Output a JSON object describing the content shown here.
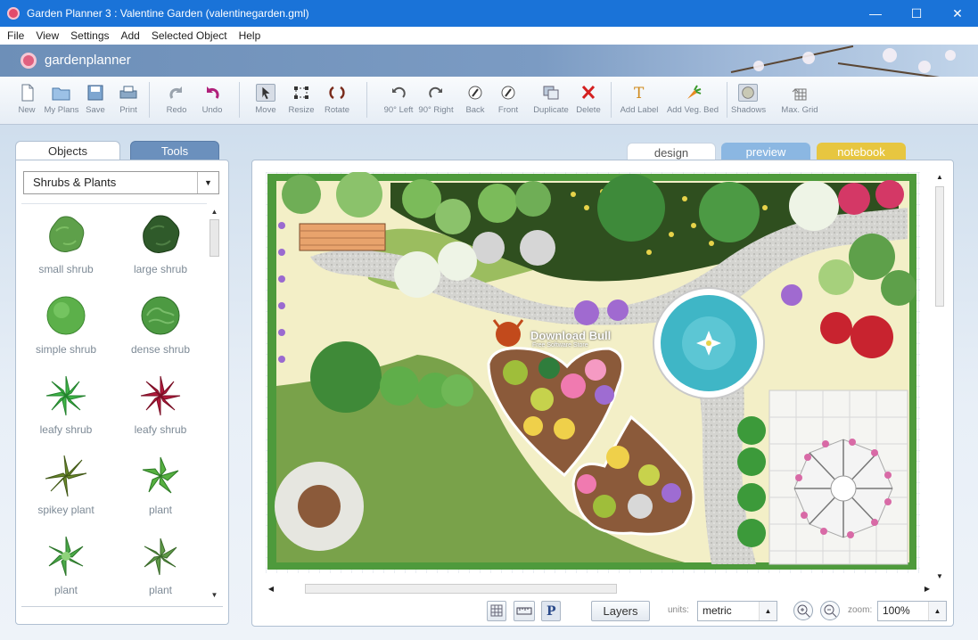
{
  "window": {
    "title": "Garden Planner 3 : Valentine Garden (valentinegarden.gml)",
    "controls": [
      "—",
      "☐",
      "✕"
    ]
  },
  "menu": [
    "File",
    "View",
    "Settings",
    "Add",
    "Selected Object",
    "Help"
  ],
  "banner": {
    "logo": "gardenplanner"
  },
  "toolbar": {
    "new": "New",
    "my_plans": "My Plans",
    "save": "Save",
    "print": "Print",
    "redo": "Redo",
    "undo": "Undo",
    "move": "Move",
    "resize": "Resize",
    "rotate": "Rotate",
    "left90": "90° Left",
    "right90": "90° Right",
    "back": "Back",
    "front": "Front",
    "duplicate": "Duplicate",
    "delete": "Delete",
    "add_label": "Add Label",
    "add_veg_bed": "Add Veg. Bed",
    "shadows": "Shadows",
    "max_grid": "Max. Grid"
  },
  "left_panel": {
    "tab_objects": "Objects",
    "tab_tools": "Tools",
    "category": "Shrubs & Plants",
    "items": [
      {
        "label": "small shrub",
        "color": "#5ea04a"
      },
      {
        "label": "large shrub",
        "color": "#2f5a2a"
      },
      {
        "label": "simple shrub",
        "color": "#5cb04a"
      },
      {
        "label": "dense shrub",
        "color": "#4d9a42"
      },
      {
        "label": "leafy shrub",
        "color": "#3fb548"
      },
      {
        "label": "leafy shrub",
        "color": "#b3193b"
      },
      {
        "label": "spikey plant",
        "color": "#6a8a2a"
      },
      {
        "label": "plant",
        "color": "#56b040"
      },
      {
        "label": "plant",
        "color": "#4aa848"
      },
      {
        "label": "plant",
        "color": "#5f9a48"
      }
    ]
  },
  "view_tabs": {
    "design": "design",
    "preview": "preview",
    "notebook": "notebook"
  },
  "canvas": {
    "watermark_title": "Download Bull",
    "watermark_sub": "Free Software Store"
  },
  "bottom_bar": {
    "layers": "Layers",
    "units_label": "units:",
    "units_value": "metric",
    "zoom_label": "zoom:",
    "zoom_value": "100%"
  },
  "colors": {
    "titlebar": "#1a73d8",
    "lawn": "#79a24a",
    "path": "#cfcfcf",
    "hedge": "#4e9a3c",
    "water": "#3fb6c6"
  }
}
